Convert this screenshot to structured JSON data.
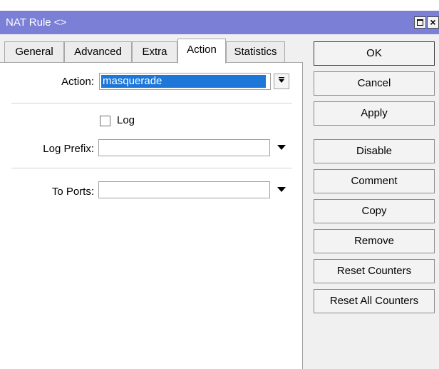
{
  "window": {
    "title": "NAT Rule <>",
    "controls": {
      "maximize": "maximize-icon",
      "close": "×"
    }
  },
  "tabs": [
    {
      "label": "General"
    },
    {
      "label": "Advanced"
    },
    {
      "label": "Extra"
    },
    {
      "label": "Action"
    },
    {
      "label": "Statistics"
    }
  ],
  "active_tab": "Action",
  "form": {
    "action": {
      "label": "Action:",
      "value": "masquerade"
    },
    "log": {
      "label": "Log",
      "checked": false
    },
    "log_prefix": {
      "label": "Log Prefix:",
      "value": ""
    },
    "to_ports": {
      "label": "To Ports:",
      "value": ""
    }
  },
  "buttons": {
    "ok": "OK",
    "cancel": "Cancel",
    "apply": "Apply",
    "disable": "Disable",
    "comment": "Comment",
    "copy": "Copy",
    "remove": "Remove",
    "reset_counters": "Reset Counters",
    "reset_all_counters": "Reset All Counters"
  },
  "colors": {
    "titlebar": "#7b7fd6",
    "selection": "#1d77d9"
  }
}
